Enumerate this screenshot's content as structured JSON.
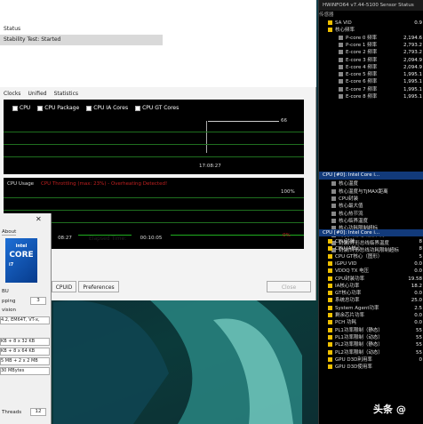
{
  "stability": {
    "status_label": "Status",
    "status_value": "Stability Test: Started",
    "tabs": [
      "Clocks",
      "Unified",
      "Statistics"
    ],
    "checkboxes": [
      "CPU",
      "CPU Package",
      "CPU IA Cores",
      "CPU GT Cores"
    ],
    "graph1_max": "66",
    "graph1_time": "17:08:27",
    "graph2_tabs": [
      "CPU Usage",
      "CPU Throttling (max: 23%) - Overheating Detected!"
    ],
    "graph2_top": "100%",
    "graph2_bottom": "0%",
    "started_time": "08:27",
    "elapsed_label": "Elapsed Time:",
    "elapsed_value": "00:10:05",
    "buttons": [
      "CPUID",
      "Preferences",
      "Close"
    ]
  },
  "cpuz": {
    "about": "About",
    "brand": "intel",
    "core": "CORE",
    "tier": "i7",
    "rows": [
      "BU",
      "pping",
      "vision",
      "4.2, EM64T, VT-x,",
      "KB + 8 x 32 KB",
      "KB + 8 x 64 KB",
      "5 MB + 2 x 2 MB",
      "30 MBytes"
    ],
    "stepping_value": "3",
    "threads_label": "Threads",
    "threads_value": "12"
  },
  "hwinfo": {
    "title": "HWiNFO64 v7.44-5100 Sensor Status",
    "header_col": "传感器",
    "rows": [
      {
        "label": "SA VID",
        "value": "0.9"
      },
      {
        "label": "核心频率",
        "value": ""
      },
      {
        "label": "P-core 0 频率",
        "value": "2,194.6"
      },
      {
        "label": "P-core 1 频率",
        "value": "2,793.2"
      },
      {
        "label": "E-core 2 频率",
        "value": "2,793.2"
      },
      {
        "label": "E-core 3 频率",
        "value": "2,094.9"
      },
      {
        "label": "E-core 4 频率",
        "value": "2,094.9"
      },
      {
        "label": "E-core 5 频率",
        "value": "1,995.1"
      },
      {
        "label": "E-core 6 频率",
        "value": "1,995.1"
      },
      {
        "label": "E-core 7 频率",
        "value": "1,995.1"
      },
      {
        "label": "E-core 8 频率",
        "value": "1,995.1"
      }
    ],
    "sec1": "CPU [#0]: Intel Core i...",
    "rows2": [
      {
        "label": "核心温度",
        "value": ""
      },
      {
        "label": "核心温度与TjMAX距离",
        "value": ""
      },
      {
        "label": "CPU封装",
        "value": ""
      },
      {
        "label": "核心最大值",
        "value": ""
      },
      {
        "label": "核心热节流",
        "value": ""
      },
      {
        "label": "核心临界温度",
        "value": ""
      },
      {
        "label": "核心功耗限制超标",
        "value": ""
      },
      {
        "label": "封装/环形总线热节流",
        "value": ""
      },
      {
        "label": "封装/环形总线临界温度",
        "value": ""
      },
      {
        "label": "封装/环形总线功耗限制超标",
        "value": ""
      }
    ],
    "sec2": "CPU [#0]: Intel Core i...",
    "rows3": [
      {
        "label": "CPU封装",
        "value": "8"
      },
      {
        "label": "CPU IA核心",
        "value": "8"
      },
      {
        "label": "CPU GT核心（图形）",
        "value": "5"
      },
      {
        "label": "iGPU VID",
        "value": "0.0"
      },
      {
        "label": "VDDQ TX 电压",
        "value": "0.0"
      },
      {
        "label": "CPU封装功率",
        "value": "19.58"
      },
      {
        "label": "IA核心功率",
        "value": "18.2"
      },
      {
        "label": "GT核心功率",
        "value": "0.0"
      },
      {
        "label": "系统总功率",
        "value": "25.0"
      },
      {
        "label": "System Agent功率",
        "value": "2.5"
      },
      {
        "label": "剩余芯片功率",
        "value": "0.0"
      },
      {
        "label": "PCH 功耗",
        "value": "0.0"
      },
      {
        "label": "PL1功率限制（静态）",
        "value": "55"
      },
      {
        "label": "PL1功率限制（动态）",
        "value": "55"
      },
      {
        "label": "PL2功率限制（静态）",
        "value": "55"
      },
      {
        "label": "PL2功率限制（动态）",
        "value": "55"
      },
      {
        "label": "GPU D3D利用率",
        "value": "0"
      },
      {
        "label": "GPU D3D使用率",
        "value": ""
      }
    ]
  },
  "watermark": "头条 @"
}
